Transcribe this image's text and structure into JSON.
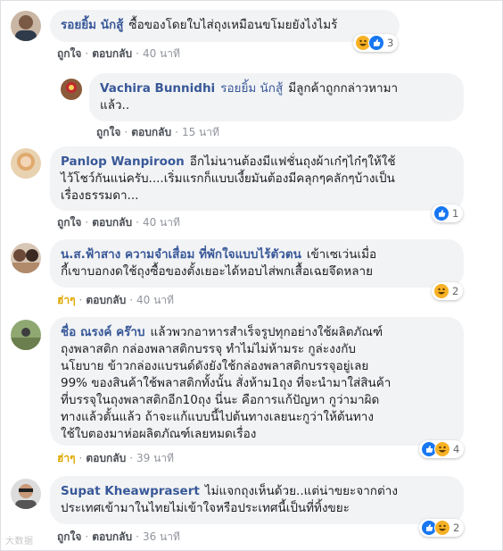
{
  "comments": [
    {
      "author": "รอยยิ้ม นักสู้",
      "text": "ซื้อของโดยใบไส่ถุงเหมือนขโมยยังไงไมร้",
      "actions": {
        "like": "ถูกใจ",
        "reply": "ตอบกลับ",
        "time": "40 นาที"
      },
      "reaction_count": "3"
    },
    {
      "author": "Vachira Bunnidhi",
      "mention": "รอยยิ้ม นักสู้",
      "text": "มีลูกค้าถูกกล่าวหามา\nแล้ว..",
      "actions": {
        "like": "ถูกใจ",
        "reply": "ตอบกลับ",
        "time": "15 นาที"
      }
    },
    {
      "author": "Panlop Wanpiroon",
      "text": "อีกไม่นานต้องมีแฟชั่นถุงผ้าเก๋ๆไก๋ๆให้ใช้\nไว้โชว์กันแน่ครับ....เริ่มแรกก็แบบเงี้ยมันต้องมีคลุกๆคลักๆบ้างเป็น\nเรื่องธรรมดา...",
      "actions": {
        "like": "ถูกใจ",
        "reply": "ตอบกลับ",
        "time": "40 นาที"
      },
      "reaction_count": "1"
    },
    {
      "author": "น.ส.ฟ้าสาง ความจำเสื่อม ที่พักใจแบบไร้ตัวตน",
      "text": "เข้าเซเว่นเมื่อ\nกี้เขาบอกงดใช้ถุงซื้อของตั้งเยอะได้หอบไส่พกเสื้อเฉยจึดหลาย",
      "actions": {
        "like": "ฮ่าๆ",
        "reply": "ตอบกลับ",
        "time": "40 นาที"
      },
      "reaction_count": "2"
    },
    {
      "author": "ชื่อ ณรงค์ คร๊าบ",
      "text": "แล้วพวกอาหารสำเร็จรูปทุกอย่างใช้ผลิตภัณฑ์\nถุงพลาสติก กล่องพลาสติกบรรจุ ทำไม่ไม่ห้ามระ กูล่ะงงกับ\nนโยบาย ข้าวกล่องแบรนด์ดังยังใช้กล่องพลาสติกบรรจุอยู่เลย\n99% ของสินค้าใช้พลาสติกทั้งนั้น สั่งห้าม1ถุง ที่จะนำมาใส่สินค้า\nที่บรรจุในถุงพลาสติกอีก10ถุง นี่นะ คือการแก้ปัญหา กูว่ามาผิด\nทางแล้วตั้นแล้ว ถ้าจะแก้แบบนี้ไปต้นทางเลยนะกูว่าให้ต้นทาง\nใช้ใบตองมาห่อผลิตภัณฑ์เลยหมดเรื่อง",
      "actions": {
        "like": "ฮ่าๆ",
        "reply": "ตอบกลับ",
        "time": "39 นาที"
      },
      "reaction_count": "4"
    },
    {
      "author": "Supat Kheawprasert",
      "text": "ไม่แจกถุงเห็นด้วย..แต่น่าขยะจากต่าง\nประเทศเข้ามาในไทยไม่เข้าใจหรือประเทศนี้เป็นที่ทิ้งขยะ",
      "actions": {
        "like": "ถูกใจ",
        "reply": "ตอบกลับ",
        "time": "36 นาที"
      },
      "reaction_count": "2"
    }
  ],
  "watermark": "大数据",
  "colors": {
    "author": "#385898",
    "bubble": "#f2f3f5",
    "meta": "#90949c",
    "haha_action": "#e0a800",
    "like_icon": "#1877f2",
    "haha_icon": "#f7b125"
  },
  "icons": [
    "haha-reaction-icon",
    "like-reaction-icon"
  ]
}
